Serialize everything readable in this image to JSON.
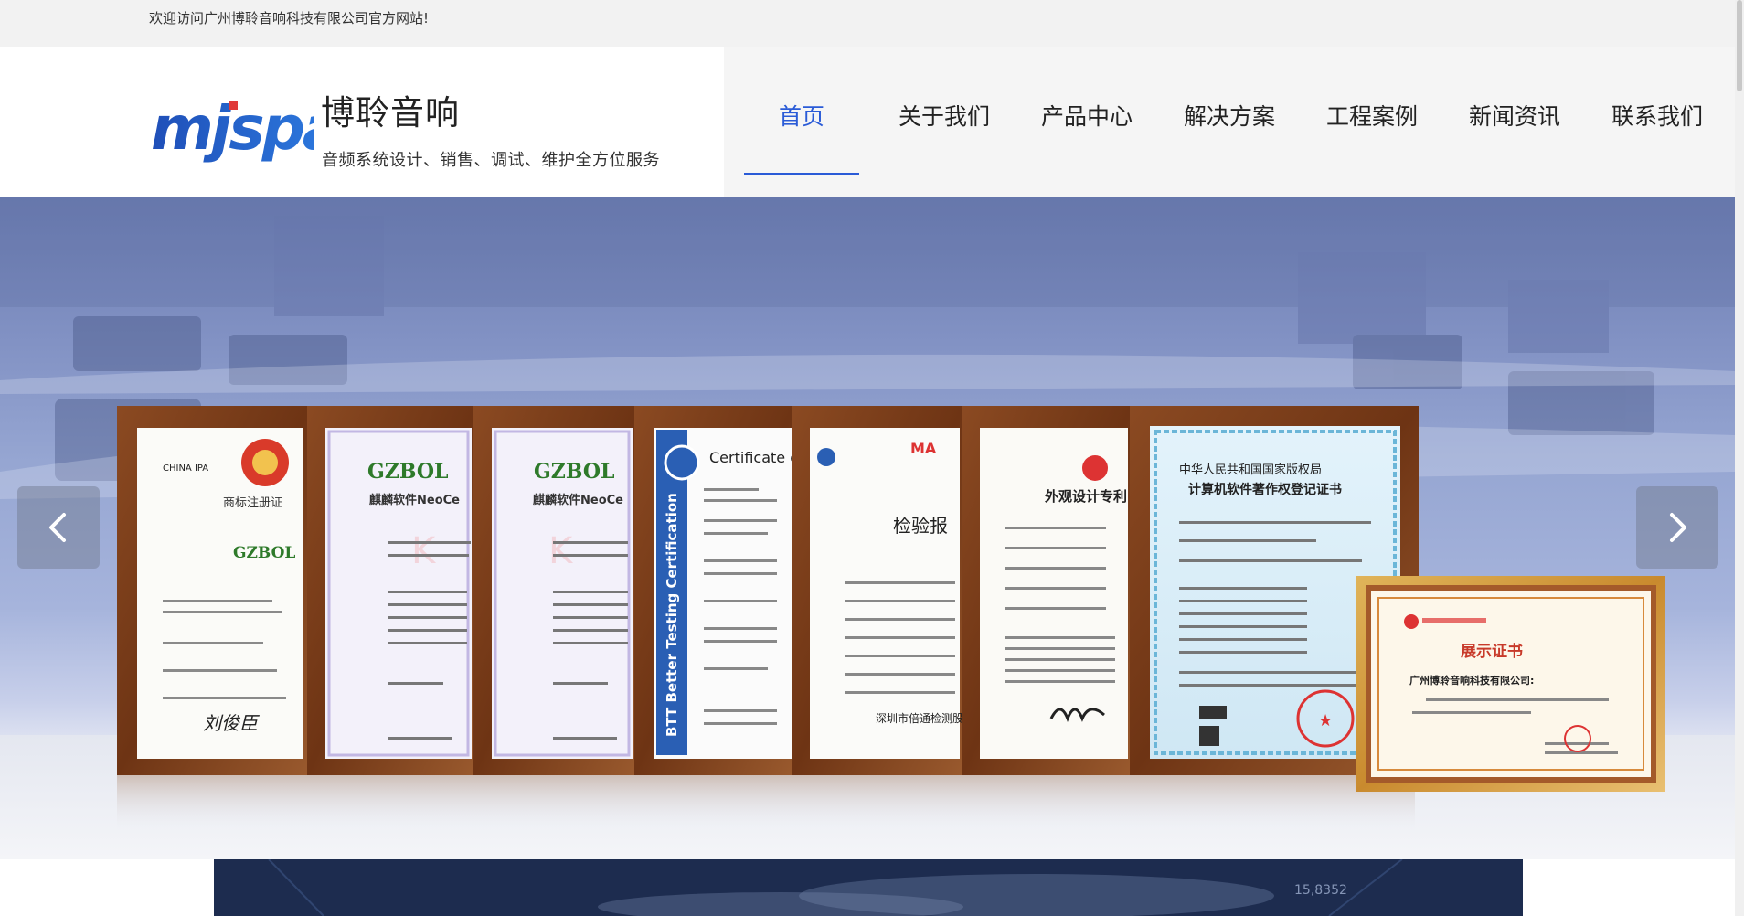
{
  "topbar": {
    "welcome": "欢迎访问广州博聆音响科技有限公司官方网站!"
  },
  "header": {
    "logo_text": "mjspa",
    "brand_name": "博聆音响",
    "brand_subtitle": "音频系统设计、销售、调试、维护全方位服务"
  },
  "nav": {
    "items": [
      {
        "label": "首页",
        "active": true
      },
      {
        "label": "关于我们"
      },
      {
        "label": "产品中心"
      },
      {
        "label": "解决方案"
      },
      {
        "label": "工程案例"
      },
      {
        "label": "新闻资讯"
      },
      {
        "label": "联系我们"
      }
    ]
  },
  "certificates": [
    {
      "title": "商标注册证",
      "brand": "GZBOL",
      "signature": "刘俊臣"
    },
    {
      "title": "GZBOL",
      "subtitle": "麒麟软件NeoCe"
    },
    {
      "title": "GZBOL",
      "subtitle": "麒麟软件NeoCe"
    },
    {
      "title": "Certificate o",
      "side": "BTT Better Testing Certification"
    },
    {
      "title": "检验报",
      "bottom": "深圳市倍通检测股份"
    },
    {
      "title": "外观设计专利"
    },
    {
      "title": "中华人民共和国国家版权局",
      "subtitle": "计算机软件著作权登记证书"
    },
    {
      "title": "展示证书",
      "company": "广州博聆音响科技有限公司:"
    }
  ],
  "colors": {
    "nav_active": "#2a5bd7",
    "topbar_bg": "#f2f2f2",
    "frame": "#7a3b1a"
  },
  "icons": {
    "prev": "chevron-left-icon",
    "next": "chevron-right-icon"
  }
}
